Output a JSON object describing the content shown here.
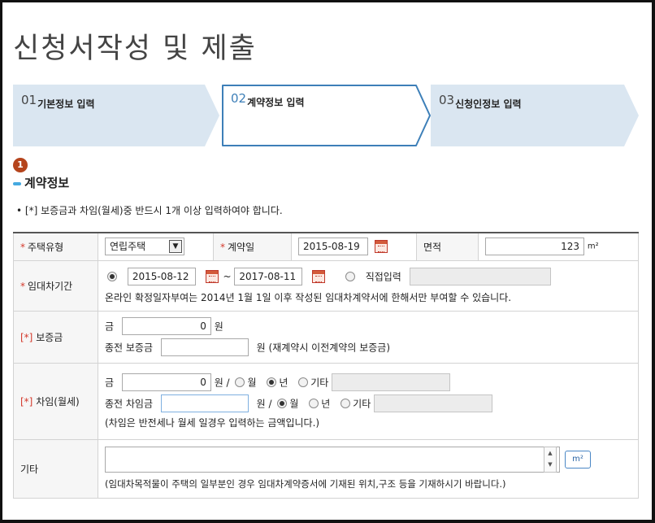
{
  "page_title": "신청서작성 및 제출",
  "steps": [
    {
      "num": "01",
      "label": "기본정보 입력",
      "active": false
    },
    {
      "num": "02",
      "label": "계약정보 입력",
      "active": true
    },
    {
      "num": "03",
      "label": "신청인정보 입력",
      "active": false
    }
  ],
  "badge": "1",
  "section_title": "계약정보",
  "notice": "• [*] 보증금과 차임(월세)중 반드시 1개 이상 입력하여야 합니다.",
  "form": {
    "housing_type": {
      "label": "주택유형",
      "value": "연립주택"
    },
    "contract_date": {
      "label": "계약일",
      "value": "2015-08-19"
    },
    "area": {
      "label": "면적",
      "value": "123",
      "unit": "m²"
    },
    "lease_period": {
      "label": "임대차기간",
      "start": "2015-08-12",
      "tilde": "~",
      "end": "2017-08-11",
      "direct_label": "직접입력",
      "note": "온라인 확정일자부여는 2014년 1월 1일 이후 작성된 임대차계약서에 한해서만 부여할 수 있습니다."
    },
    "deposit": {
      "label": "보증금",
      "prefix": "금",
      "value": "0",
      "unit": "원",
      "prev_label": "종전 보증금",
      "prev_unit": "원 (재계약시 이전계약의 보증금)"
    },
    "rent": {
      "label": "차임(월세)",
      "prefix": "금",
      "value": "0",
      "unit_slash": "원 /",
      "opt_month": "월",
      "opt_year": "년",
      "opt_other": "기타",
      "prev_label": "종전 차임금",
      "prev_unit_slash": "원 /",
      "note": "(차임은 반전세나 월세 일경우 입력하는 금액입니다.)"
    },
    "etc": {
      "label": "기타",
      "m2_button": "m²",
      "note": "(임대차목적물이 주택의 일부분인 경우 임대차계약증서에 기재된 위치,구조 등을 기재하시기 바랍니다.)"
    }
  },
  "colors": {
    "accent": "#3d7fb8",
    "step_bg": "#dae6f1",
    "required": "#d43a2c",
    "badge": "#b5441c"
  }
}
